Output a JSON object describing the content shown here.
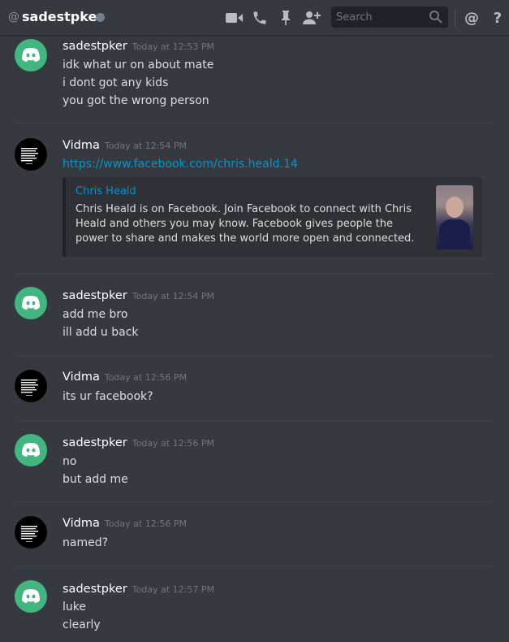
{
  "header": {
    "at_symbol": "@",
    "channel_name": "sadestpker",
    "status_color": "#747f8d",
    "search_placeholder": "Search",
    "mention_symbol": "@",
    "help_symbol": "?",
    "icons": [
      "video-call-icon",
      "voice-call-icon",
      "pin-icon",
      "add-friend-icon",
      "search-icon",
      "mentions-icon",
      "help-icon"
    ]
  },
  "colors": {
    "background": "#36393f",
    "discord_avatar": "#43b581",
    "link": "#0096cf"
  },
  "messages": [
    {
      "author": "sadestpker",
      "timestamp": "Today at 12:53 PM",
      "lines": [
        "idk what ur on about mate",
        "i dont got any kids",
        "you got the wrong person"
      ]
    },
    {
      "author": "Vidma",
      "timestamp": "Today at 12:54 PM",
      "link": "https://www.facebook.com/chris.heald.14",
      "embed": {
        "title": "Chris Heald",
        "description": "Chris Heald is on Facebook. Join Facebook to connect with Chris Heald and others you may know. Facebook gives people the power to share and makes the world more open and connected."
      }
    },
    {
      "author": "sadestpker",
      "timestamp": "Today at 12:54 PM",
      "lines": [
        "add me bro",
        "ill add u back"
      ]
    },
    {
      "author": "Vidma",
      "timestamp": "Today at 12:56 PM",
      "lines": [
        "its ur facebook?"
      ]
    },
    {
      "author": "sadestpker",
      "timestamp": "Today at 12:56 PM",
      "lines": [
        "no",
        "but add me"
      ]
    },
    {
      "author": "Vidma",
      "timestamp": "Today at 12:56 PM",
      "lines": [
        "named?"
      ]
    },
    {
      "author": "sadestpker",
      "timestamp": "Today at 12:57 PM",
      "lines": [
        "luke",
        "clearly"
      ]
    }
  ]
}
